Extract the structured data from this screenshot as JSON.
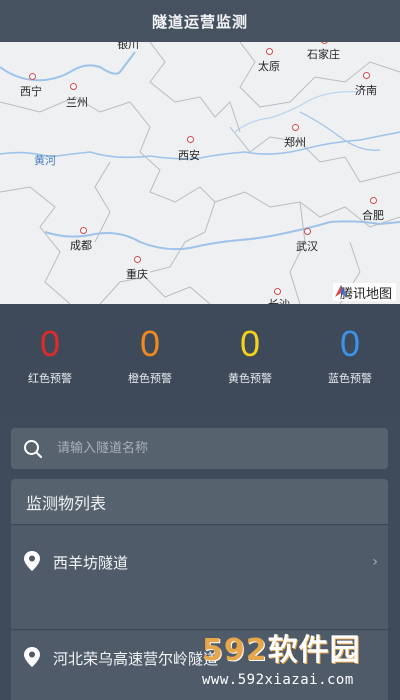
{
  "header": {
    "title": "隧道运营监测"
  },
  "map": {
    "cities": [
      {
        "name": "银川"
      },
      {
        "name": "太原"
      },
      {
        "name": "石家庄"
      },
      {
        "name": "西宁"
      },
      {
        "name": "兰州"
      },
      {
        "name": "济南"
      },
      {
        "name": "郑州"
      },
      {
        "name": "西安"
      },
      {
        "name": "合肥"
      },
      {
        "name": "成都"
      },
      {
        "name": "武汉"
      },
      {
        "name": "重庆"
      },
      {
        "name": "长沙"
      }
    ],
    "river_label": "黄河",
    "provider": "腾讯地图"
  },
  "alerts": [
    {
      "count": "0",
      "label": "红色预警",
      "color": "#e02a2a"
    },
    {
      "count": "0",
      "label": "橙色预警",
      "color": "#f08a1c"
    },
    {
      "count": "0",
      "label": "黄色预警",
      "color": "#f2d21b"
    },
    {
      "count": "0",
      "label": "蓝色预警",
      "color": "#3b92e6"
    }
  ],
  "search": {
    "placeholder": "请输入隧道名称",
    "icon": "search-icon"
  },
  "list": {
    "title": "监测物列表",
    "items": [
      {
        "name": "西羊坊隧道",
        "icon": "location-pin-icon"
      },
      {
        "name": "河北荣乌高速营尔岭隧道",
        "icon": "location-pin-icon"
      }
    ]
  },
  "watermark": {
    "logo": "592软件园",
    "logo_num": "592",
    "logo_text": "软件园",
    "url": "www.592xiazai.com"
  }
}
